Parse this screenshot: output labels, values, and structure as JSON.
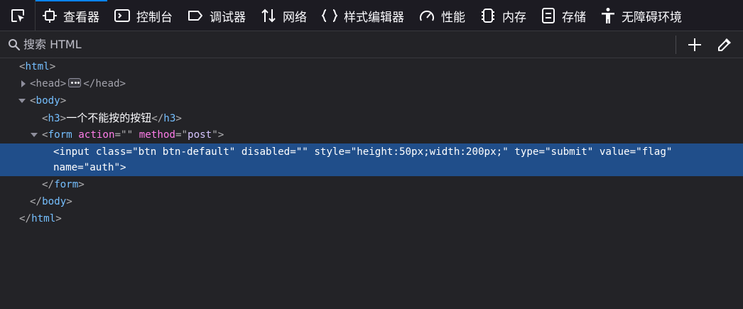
{
  "toolbar": {
    "tabs": [
      {
        "id": "inspector",
        "label": "查看器",
        "icon": "inspector-icon",
        "active": true
      },
      {
        "id": "console",
        "label": "控制台",
        "icon": "console-icon"
      },
      {
        "id": "debugger",
        "label": "调试器",
        "icon": "debugger-icon"
      },
      {
        "id": "network",
        "label": "网络",
        "icon": "network-icon"
      },
      {
        "id": "styles",
        "label": "样式编辑器",
        "icon": "style-editor-icon"
      },
      {
        "id": "performance",
        "label": "性能",
        "icon": "performance-icon"
      },
      {
        "id": "memory",
        "label": "内存",
        "icon": "memory-icon"
      },
      {
        "id": "storage",
        "label": "存储",
        "icon": "storage-icon"
      },
      {
        "id": "accessibility",
        "label": "无障碍环境",
        "icon": "accessibility-icon"
      }
    ],
    "accent": "#0a84ff"
  },
  "search": {
    "placeholder": "搜索 HTML",
    "value": ""
  },
  "tree": {
    "html_open": {
      "name": "html"
    },
    "head": {
      "name": "head"
    },
    "body_open": {
      "name": "body"
    },
    "h3": {
      "name": "h3",
      "text": "一个不能按的按钮"
    },
    "form_open": {
      "name": "form",
      "attrs": [
        {
          "name": "action",
          "value": ""
        },
        {
          "name": "method",
          "value": "post"
        }
      ]
    },
    "input": {
      "name": "input",
      "attrs": [
        {
          "name": "class",
          "value": "btn btn-default"
        },
        {
          "name": "disabled",
          "value": ""
        },
        {
          "name": "style",
          "value": "height:50px;width:200px;"
        },
        {
          "name": "type",
          "value": "submit"
        },
        {
          "name": "value",
          "value": "flag"
        },
        {
          "name": "name",
          "value": "auth"
        }
      ]
    },
    "form_close": {
      "name": "form"
    },
    "body_close": {
      "name": "body"
    },
    "html_close": {
      "name": "html"
    }
  },
  "colors": {
    "selected_row": "#204e8a",
    "tag": "#75bfff",
    "attr": "#ff7de9",
    "value": "#d6c4ff"
  }
}
